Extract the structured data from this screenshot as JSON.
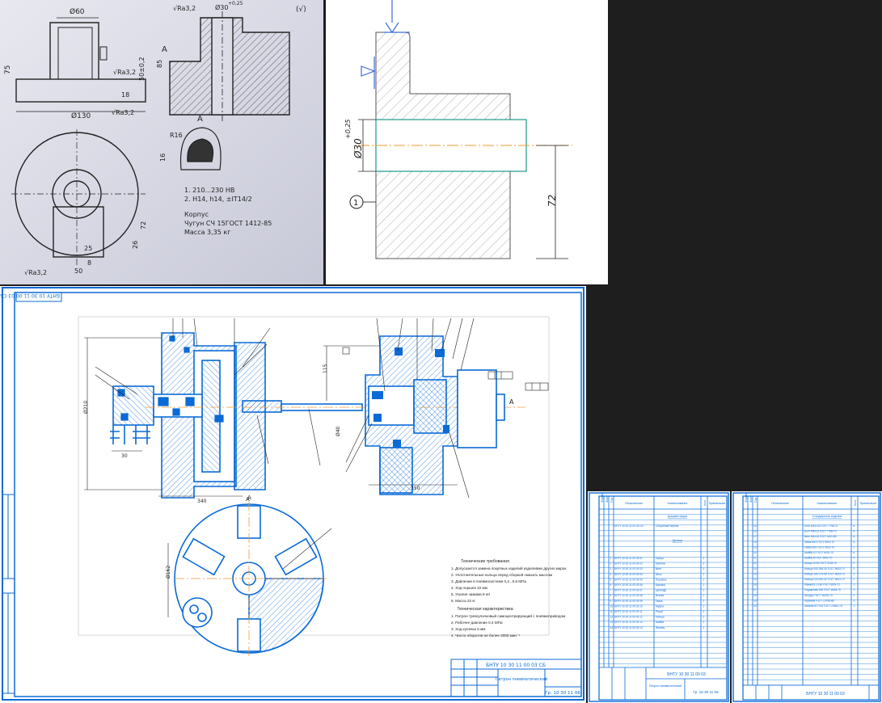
{
  "sketch": {
    "dims": [
      "Ø60",
      "Ø30",
      "75",
      "85",
      "50±0,2",
      "18",
      "Ø130",
      "R16",
      "16",
      "72",
      "25",
      "26",
      "50",
      "8"
    ],
    "roughness": [
      "√Ra3,2",
      "√Ra3,2",
      "√Ra3,2",
      "√Ra3,2",
      "(√)"
    ],
    "tol_top": "+0,25",
    "view_letter": "A",
    "notes": [
      "1. 210...230 HB",
      "2. H14, h14, ±IT14/2"
    ],
    "part_name": "Корпус",
    "material": "Чугун СЧ 15ГОСТ 1412-85",
    "mass": "Масса 3,35 кг"
  },
  "section": {
    "diameter": "Ø30",
    "tolerance": "+0,25",
    "length": "72",
    "surface_no": "1"
  },
  "assembly": {
    "corner_code": "БНТУ 10 30 11 00 03 СБ",
    "view_letter": "A",
    "section_letter": "A",
    "dims": [
      "115",
      "Ø162",
      "Ø210",
      "30",
      "Ø40",
      "340",
      "350"
    ],
    "tech_title": "Технические требования",
    "tech_items": [
      "1. Допускается замена покупных изделий изделиями других марок",
      "2. Уплотнительные кольца перед сборкой смазать маслом",
      "3. Давление в пневмосистеме 0,4...0,6 МПа",
      "4. Ход поршня 10 мм",
      "5. Усилие зажима 8 кН",
      "6. Масса 22 кг"
    ],
    "char_title": "Техническая характеристика",
    "char_items": [
      "1. Патрон трехкулачковый самоцентрирующий с пневмоприводом",
      "2. Рабочее давление 0,4 МПа",
      "3. Ход кулачка 5 мм",
      "4. Число оборотов не более 2000 мин⁻¹"
    ],
    "title_block": {
      "code": "БНТУ 10 30 11 00 03 СБ",
      "name": "Патрон пневматический",
      "sheet": "Гр. 10 30 11 06"
    }
  },
  "spec1": {
    "headers": [
      "Формат",
      "Зона",
      "Поз.",
      "Обозначение",
      "Наименование",
      "Кол.",
      "Примечание"
    ],
    "section_docs": "Документация",
    "section_parts": "Детали",
    "doc_rows": [
      [
        "",
        "",
        "",
        "БНТУ 10 30 11 00 03 СБ",
        "Сборочный чертеж",
        "",
        ""
      ]
    ],
    "part_rows": [
      [
        "",
        "",
        "1",
        "БНТУ 10 30 11 00 03 01",
        "Корпус",
        "1",
        ""
      ],
      [
        "",
        "",
        "2",
        "БНТУ 10 30 11 00 03 02",
        "Кулачок",
        "3",
        ""
      ],
      [
        "",
        "",
        "3",
        "БНТУ 10 30 11 00 03 03",
        "Винт",
        "3",
        ""
      ],
      [
        "",
        "",
        "4",
        "БНТУ 10 30 11 00 03 04",
        "Шток",
        "1",
        ""
      ],
      [
        "",
        "",
        "5",
        "БНТУ 10 30 11 00 03 05",
        "Поршень",
        "1",
        ""
      ],
      [
        "",
        "",
        "6",
        "БНТУ 10 30 11 00 03 06",
        "Крышка",
        "1",
        ""
      ],
      [
        "",
        "",
        "7",
        "БНТУ 10 30 11 00 03 07",
        "Цилиндр",
        "1",
        ""
      ],
      [
        "",
        "",
        "8",
        "БНТУ 10 30 11 00 03 08",
        "Втулка",
        "1",
        ""
      ],
      [
        "",
        "",
        "9",
        "БНТУ 10 30 11 00 03 09",
        "Гайка",
        "2",
        ""
      ],
      [
        "",
        "",
        "10",
        "БНТУ 10 30 11 00 03 10",
        "Муфта",
        "1",
        ""
      ],
      [
        "",
        "",
        "11",
        "БНТУ 10 30 11 00 03 11",
        "Рычаг",
        "3",
        ""
      ],
      [
        "",
        "",
        "12",
        "БНТУ 10 30 11 00 03 12",
        "Кольцо",
        "2",
        ""
      ],
      [
        "",
        "",
        "13",
        "БНТУ 10 30 11 00 03 13",
        "Шайба",
        "2",
        ""
      ],
      [
        "",
        "",
        "14",
        "БНТУ 10 30 11 00 03 14",
        "Фланец",
        "1",
        ""
      ]
    ],
    "title_code": "БНТУ 10 30 11 00 03",
    "title_name": "Патрон пневматический",
    "title_group": "Гр. 10 30 11 06"
  },
  "spec2": {
    "headers": [
      "Формат",
      "Зона",
      "Поз.",
      "Обозначение",
      "Наименование",
      "Кол.",
      "Примечание"
    ],
    "section_std": "Стандартные изделия",
    "std_rows": [
      [
        "",
        "",
        "15",
        "",
        "Болт М10×30 ГОСТ 7798-70",
        "6",
        ""
      ],
      [
        "",
        "",
        "16",
        "",
        "Болт М8×25 ГОСТ 7798-70",
        "4",
        ""
      ],
      [
        "",
        "",
        "17",
        "",
        "Винт М6×16 ГОСТ 1491-80",
        "6",
        ""
      ],
      [
        "",
        "",
        "18",
        "",
        "Гайка М10 ГОСТ 5915-70",
        "6",
        ""
      ],
      [
        "",
        "",
        "19",
        "",
        "Гайка М20 ГОСТ 5915-70",
        "1",
        ""
      ],
      [
        "",
        "",
        "20",
        "",
        "Шайба 10 ГОСТ 6402-70",
        "6",
        ""
      ],
      [
        "",
        "",
        "21",
        "",
        "Шайба 8 ГОСТ 6402-70",
        "4",
        ""
      ],
      [
        "",
        "",
        "22",
        "",
        "Штифт 6×30 ГОСТ 3128-70",
        "2",
        ""
      ],
      [
        "",
        "",
        "23",
        "",
        "Кольцо 040-045-30 ГОСТ 9833-73",
        "2",
        ""
      ],
      [
        "",
        "",
        "24",
        "",
        "Кольцо 160-170-58 ГОСТ 9833-73",
        "1",
        ""
      ],
      [
        "",
        "",
        "25",
        "",
        "Кольцо 025-030-30 ГОСТ 9833-73",
        "2",
        ""
      ],
      [
        "",
        "",
        "26",
        "",
        "Манжета 1-160 ГОСТ 6678-72",
        "1",
        ""
      ],
      [
        "",
        "",
        "27",
        "",
        "Подшипник 208 ГОСТ 8338-75",
        "2",
        ""
      ],
      [
        "",
        "",
        "28",
        "",
        "Штуцер ГОСТ 16078-70",
        "1",
        ""
      ],
      [
        "",
        "",
        "29",
        "",
        "Пружина ГОСТ 13766-86",
        "3",
        ""
      ],
      [
        "",
        "",
        "30",
        "",
        "Шпонка 8×7×32 ГОСТ 23360-78",
        "1",
        ""
      ]
    ],
    "title_code": "БНТУ 10 30 11 00 03"
  }
}
